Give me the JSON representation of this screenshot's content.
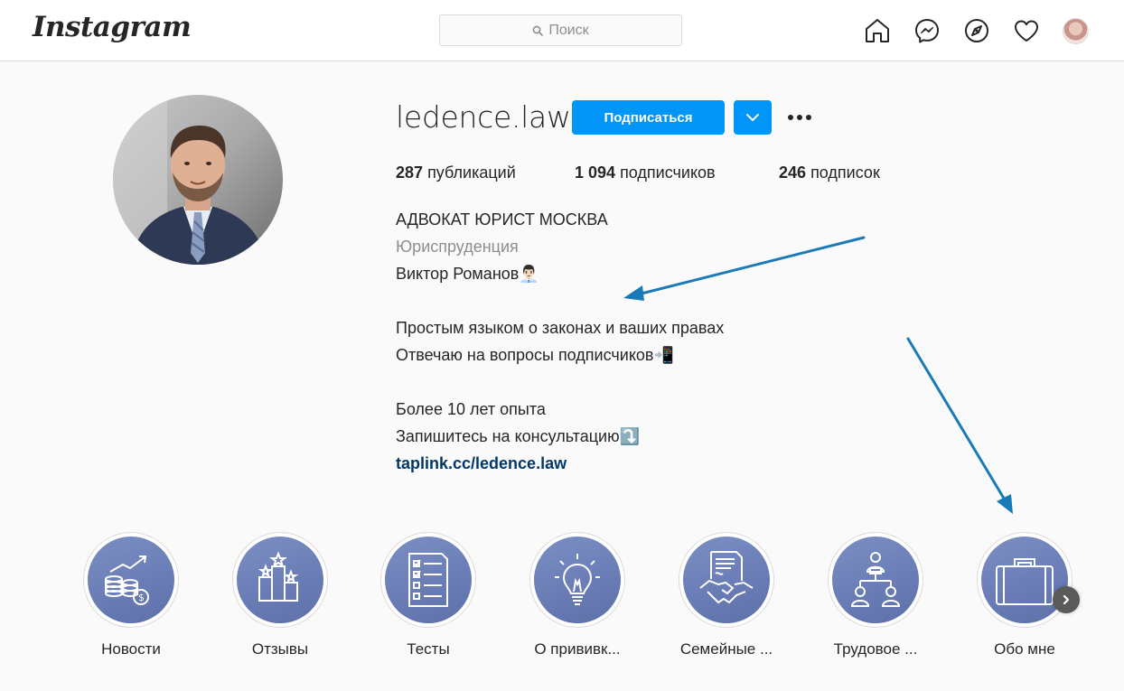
{
  "header": {
    "logo": "Instagram",
    "search_placeholder": "Поиск",
    "icons": [
      "home-icon",
      "messenger-icon",
      "explore-icon",
      "heart-icon",
      "avatar"
    ]
  },
  "profile": {
    "username": "ledence.law",
    "follow_label": "Подписаться",
    "stats": {
      "posts_count": "287",
      "posts_label": "публикаций",
      "followers_count": "1 094",
      "followers_label": "подписчиков",
      "following_count": "246",
      "following_label": "подписок"
    },
    "bio": {
      "name": "АДВОКАТ ЮРИСТ МОСКВА",
      "category": "Юриспруденция",
      "line1": "Виктор Романов👨🏻‍💼",
      "line2": "Простым языком о законах и ваших правах",
      "line3": "Отвечаю на вопросы подписчиков📲",
      "line4": "Более 10 лет опыта",
      "line5": "Запишитесь на консультацию⤵️",
      "link": "taplink.cc/ledence.law"
    }
  },
  "highlights": [
    {
      "label": "Новости",
      "icon": "coins-growth-icon"
    },
    {
      "label": "Отзывы",
      "icon": "podium-stars-icon"
    },
    {
      "label": "Тесты",
      "icon": "checklist-icon"
    },
    {
      "label": "О прививк...",
      "icon": "lightbulb-icon"
    },
    {
      "label": "Семейные ...",
      "icon": "handshake-contract-icon"
    },
    {
      "label": "Трудовое ...",
      "icon": "org-chart-icon"
    },
    {
      "label": "Обо мне",
      "icon": "briefcase-icon"
    }
  ],
  "colors": {
    "primary_button": "#0095f6",
    "link": "#00376b",
    "annotation_arrow": "#1a7ab8",
    "highlight_bg": "#6a7db6"
  }
}
